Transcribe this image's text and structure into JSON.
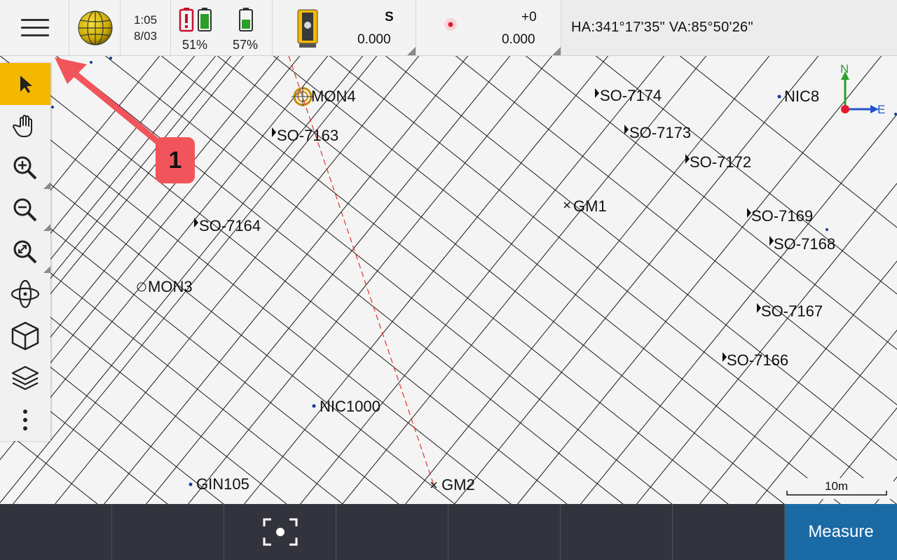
{
  "status_bar": {
    "time": "1:05",
    "date": "8/03",
    "battery_internal_pct": "51%",
    "battery_external_pct": "57%",
    "instrument": {
      "face": "S",
      "value": "0.000"
    },
    "target": {
      "offset": "+0",
      "value": "0.000"
    },
    "angles": "HA:341°17'35\"  VA:85°50'26\""
  },
  "map": {
    "points": [
      {
        "name": "MON4"
      },
      {
        "name": "SO-7174"
      },
      {
        "name": "NIC8"
      },
      {
        "name": "SO-7163"
      },
      {
        "name": "SO-7173"
      },
      {
        "name": "SO-7172"
      },
      {
        "name": "GM1"
      },
      {
        "name": "SO-7169"
      },
      {
        "name": "SO-7168"
      },
      {
        "name": "SO-7164"
      },
      {
        "name": "MON3"
      },
      {
        "name": "SO-7167"
      },
      {
        "name": "SO-7166"
      },
      {
        "name": "NIC1000"
      },
      {
        "name": "GIN105"
      },
      {
        "name": "GM2"
      }
    ],
    "north_label": "N",
    "east_label": "E",
    "scale_label": "10m"
  },
  "toolbar": {
    "tools": [
      "select-icon",
      "pan-icon",
      "zoom-in-icon",
      "zoom-out-icon",
      "zoom-extents-icon",
      "orbit-icon",
      "view-cube-icon",
      "layers-icon",
      "more-icon"
    ]
  },
  "bottom_bar": {
    "measure_label": "Measure"
  },
  "callout": {
    "number": "1"
  },
  "colors": {
    "active_tool": "#f5b800",
    "measure_button": "#1a6aa6",
    "bottom_bar": "#33333d",
    "callout": "#f2545b"
  }
}
